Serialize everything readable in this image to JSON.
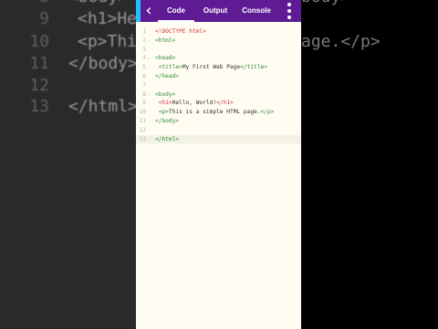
{
  "background": {
    "lines": [
      {
        "num": "9",
        "code": "<h1>He"
      },
      {
        "num": "10",
        "code": "<p>This is a simple HTML page.</p>"
      },
      {
        "num": "11",
        "code": "</body>"
      },
      {
        "num": "12",
        "code": ""
      },
      {
        "num": "13",
        "code": "</html>"
      }
    ]
  },
  "toolbar": {
    "back_icon": "chevron-left-icon",
    "tabs": [
      "Code",
      "Output",
      "Console"
    ],
    "active_tab": "Code",
    "menu_icon": "more-vertical-icon",
    "accent_color": "#5e1b94"
  },
  "editor": {
    "lines": [
      {
        "num": "1",
        "fold": "",
        "doctype": "<!DOCTYPE html>"
      },
      {
        "num": "2",
        "fold": "⌄",
        "open": "<html>"
      },
      {
        "num": "3",
        "fold": ""
      },
      {
        "num": "4",
        "fold": "⌄",
        "open": "<head>"
      },
      {
        "num": "5",
        "fold": "",
        "open": "<title>",
        "text": "My First Web Page",
        "close": "</title>"
      },
      {
        "num": "6",
        "fold": "",
        "open": "</head>"
      },
      {
        "num": "7",
        "fold": ""
      },
      {
        "num": "8",
        "fold": "⌄",
        "open": "<body>"
      },
      {
        "num": "9",
        "fold": "",
        "open": "<h1>",
        "text": "Hello, World!",
        "close": "</h1>"
      },
      {
        "num": "10",
        "fold": "",
        "open": "<p>",
        "text": "This is a simple HTML page.",
        "close": "</p>"
      },
      {
        "num": "11",
        "fold": "",
        "open": "</body>"
      },
      {
        "num": "12",
        "fold": ""
      },
      {
        "num": "13",
        "fold": "",
        "open": "</html>"
      }
    ]
  }
}
